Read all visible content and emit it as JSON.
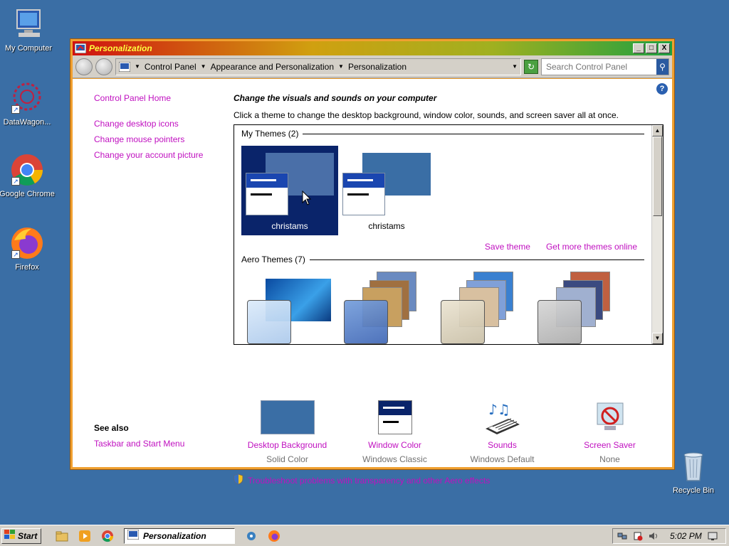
{
  "desktop": {
    "icons": [
      {
        "label": "My Computer"
      },
      {
        "label": "DataWagon..."
      },
      {
        "label": "Google Chrome"
      },
      {
        "label": "Firefox"
      }
    ],
    "recycle_bin": "Recycle Bin"
  },
  "window": {
    "title": "Personalization",
    "controls": {
      "minimize": "_",
      "maximize": "□",
      "close": "X"
    }
  },
  "addressbar": {
    "crumbs": [
      "Control Panel",
      "Appearance and Personalization",
      "Personalization"
    ],
    "search_placeholder": "Search Control Panel"
  },
  "left_pane": {
    "home": "Control Panel Home",
    "links": [
      "Change desktop icons",
      "Change mouse pointers",
      "Change your account picture"
    ],
    "see_also_heading": "See also",
    "see_also_links": [
      "Taskbar and Start Menu"
    ]
  },
  "main": {
    "heading": "Change the visuals and sounds on your computer",
    "subheading": "Click a theme to change the desktop background, window color, sounds, and screen saver all at once.",
    "my_themes_label": "My Themes (2)",
    "my_themes": [
      {
        "name": "christams",
        "selected": true
      },
      {
        "name": "christams",
        "selected": false
      }
    ],
    "save_theme": "Save theme",
    "get_more": "Get more themes online",
    "aero_themes_label": "Aero Themes (7)",
    "help": "?"
  },
  "bottom": [
    {
      "link": "Desktop Background",
      "value": "Solid Color"
    },
    {
      "link": "Window Color",
      "value": "Windows Classic"
    },
    {
      "link": "Sounds",
      "value": "Windows Default"
    },
    {
      "link": "Screen Saver",
      "value": "None"
    }
  ],
  "troubleshoot": "Troubleshoot problems with transparency and other Aero effects",
  "taskbar": {
    "start": "Start",
    "active_task": "Personalization",
    "clock": "5:02 PM"
  },
  "colors": {
    "desktop": "#3a6ea5",
    "link": "#c010c0",
    "selection": "#0a246a",
    "window_border": "#f0a030"
  }
}
